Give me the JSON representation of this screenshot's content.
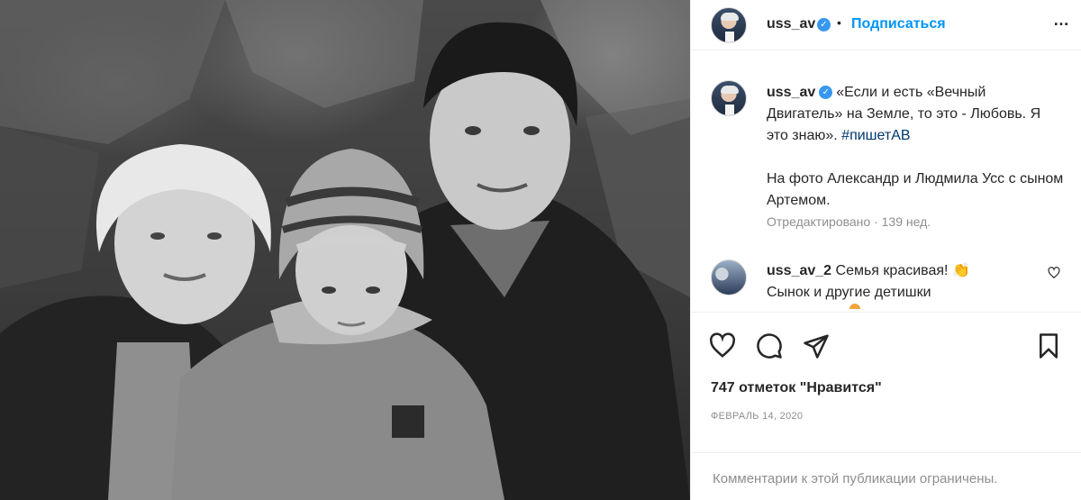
{
  "post": {
    "username": "uss_av",
    "verified_mark": "✓",
    "separator": "•",
    "follow_label": "Подписаться",
    "more_label": "…"
  },
  "caption": {
    "username": "uss_av",
    "quote": "«Если и есть «Вечный Двигатель» на Земле, то это - Любовь. Я это знаю».",
    "hashtag": "#пишетАВ",
    "line2": "На фото Александр и Людмила Усс с сыном Артемом.",
    "edited": "Отредактировано · 139 нед."
  },
  "comment": {
    "username": "uss_av_2",
    "text": "Семья красивая!",
    "emoji": "👏",
    "text2": "Сынок и другие детишки"
  },
  "actions": {
    "like_icon": "heart-icon",
    "comment_icon": "comment-icon",
    "share_icon": "paper-plane-icon",
    "save_icon": "bookmark-icon"
  },
  "likes": "747 отметок \"Нравится\"",
  "date": "ФЕВРАЛЬ 14, 2020",
  "comments_limited": "Комментарии к этой публикации ограничены."
}
